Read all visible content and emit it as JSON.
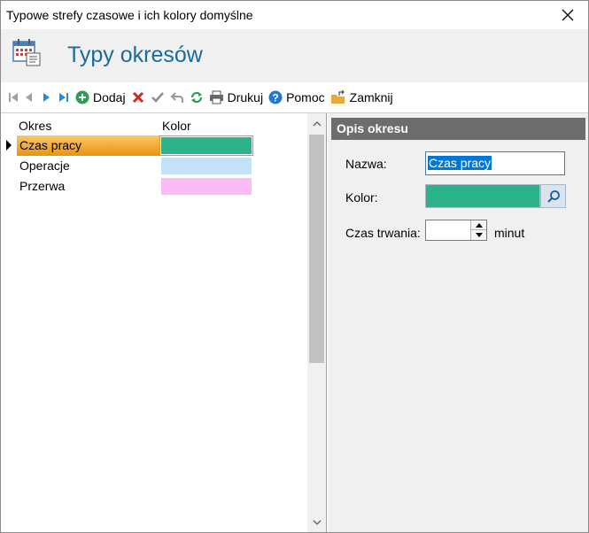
{
  "window": {
    "title": "Typowe strefy czasowe i ich kolory domyślne"
  },
  "header": {
    "title": "Typy okresów",
    "icon": "calendar-icon"
  },
  "toolbar": {
    "add_label": "Dodaj",
    "print_label": "Drukuj",
    "help_label": "Pomoc",
    "close_label": "Zamknij"
  },
  "grid": {
    "columns": [
      "Okres",
      "Kolor"
    ],
    "rows": [
      {
        "name": "Czas pracy",
        "color": "#2db38a",
        "selected": true
      },
      {
        "name": "Operacje",
        "color": "#c4e2f7",
        "selected": false
      },
      {
        "name": "Przerwa",
        "color": "#fbbcf6",
        "selected": false
      }
    ]
  },
  "details": {
    "title": "Opis okresu",
    "name_label": "Nazwa:",
    "name_value": "Czas pracy",
    "color_label": "Kolor:",
    "color_value": "#2db38a",
    "duration_label": "Czas trwania:",
    "duration_value": "",
    "duration_unit": "minut"
  },
  "colors": {
    "accent": "#1a6a9c",
    "selection": "#e8930e",
    "panel_header": "#6d6d6d"
  }
}
